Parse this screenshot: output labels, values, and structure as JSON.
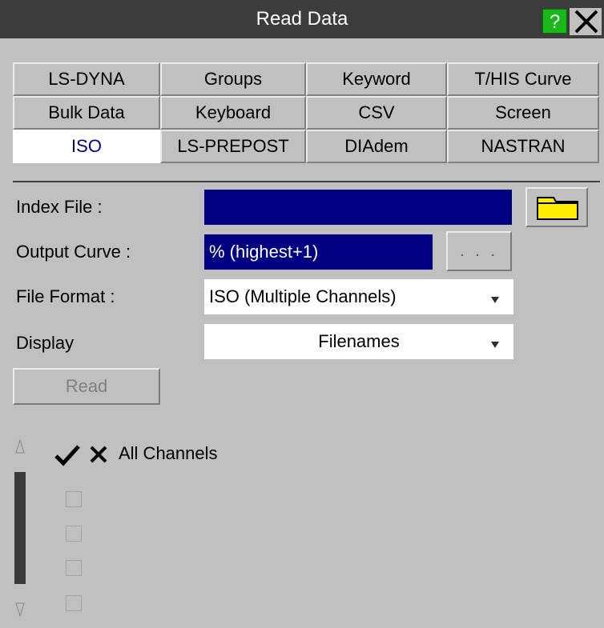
{
  "window": {
    "title": "Read Data",
    "help_label": "?"
  },
  "tabs": [
    [
      "LS-DYNA",
      "Groups",
      "Keyword",
      "T/HIS Curve"
    ],
    [
      "Bulk Data",
      "Keyboard",
      "CSV",
      "Screen"
    ],
    [
      "ISO",
      "LS-PREPOST",
      "DIAdem",
      "NASTRAN"
    ]
  ],
  "active_tab": "ISO",
  "form": {
    "index_file_label": "Index File :",
    "index_file_value": "",
    "output_curve_label": "Output Curve :",
    "output_curve_value": "% (highest+1)",
    "output_curve_more": ". . .",
    "file_format_label": "File Format :",
    "file_format_value": "ISO (Multiple Channels)",
    "display_label": "Display",
    "display_value": "Filenames",
    "read_label": "Read"
  },
  "channels": {
    "all_label": "All Channels",
    "rows": [
      {
        "checked": false
      },
      {
        "checked": false
      },
      {
        "checked": false
      },
      {
        "checked": false
      }
    ]
  },
  "colors": {
    "panel": "#c0c0c0",
    "titlebar": "#3c3c3c",
    "field_selected": "#000080",
    "active_tab_text": "#00007a",
    "folder": "#ffee00",
    "help": "#18b818"
  }
}
